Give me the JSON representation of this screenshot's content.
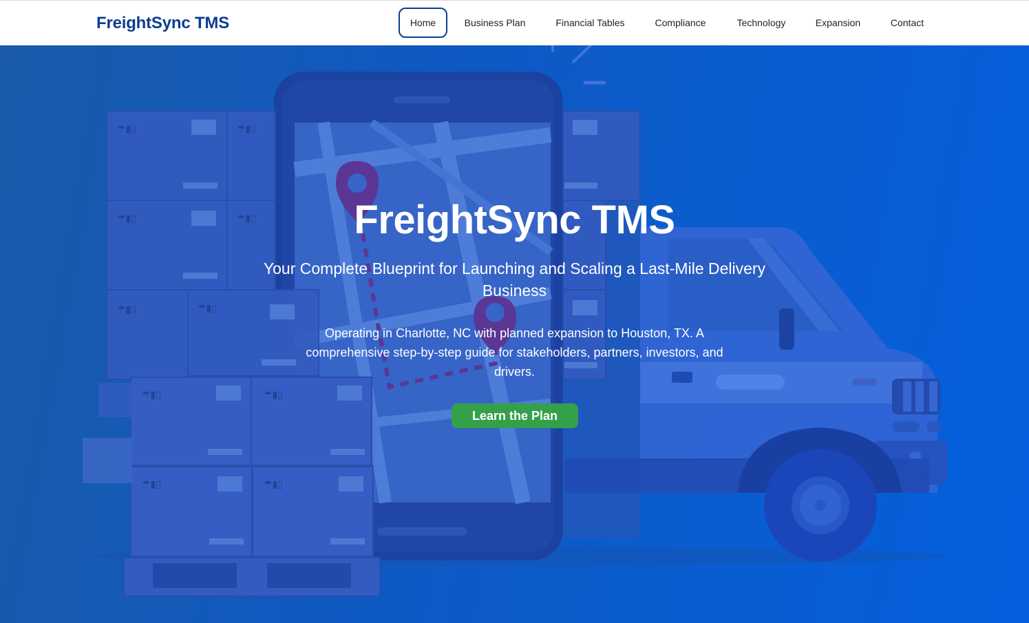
{
  "brand": "FreightSync TMS",
  "nav": {
    "items": [
      {
        "label": "Home",
        "active": true
      },
      {
        "label": "Business Plan",
        "active": false
      },
      {
        "label": "Financial Tables",
        "active": false
      },
      {
        "label": "Compliance",
        "active": false
      },
      {
        "label": "Technology",
        "active": false
      },
      {
        "label": "Expansion",
        "active": false
      },
      {
        "label": "Contact",
        "active": false
      }
    ]
  },
  "hero": {
    "title": "FreightSync TMS",
    "subtitle": "Your Complete Blueprint for Launching and Scaling a Last-Mile Delivery Business",
    "description": "Operating in Charlotte, NC with planned expansion to Houston, TX. A comprehensive step-by-step guide for stakeholders, partners, investors, and drivers.",
    "cta_label": "Learn the Plan"
  },
  "colors": {
    "brand": "#0b3d91",
    "cta": "#34a04a",
    "hero_start": "#1a5ba6",
    "hero_end": "#0062e3"
  },
  "icons": {
    "illustration": "delivery-truck-phone-boxes-illustration",
    "pin": "map-pin-icon"
  }
}
